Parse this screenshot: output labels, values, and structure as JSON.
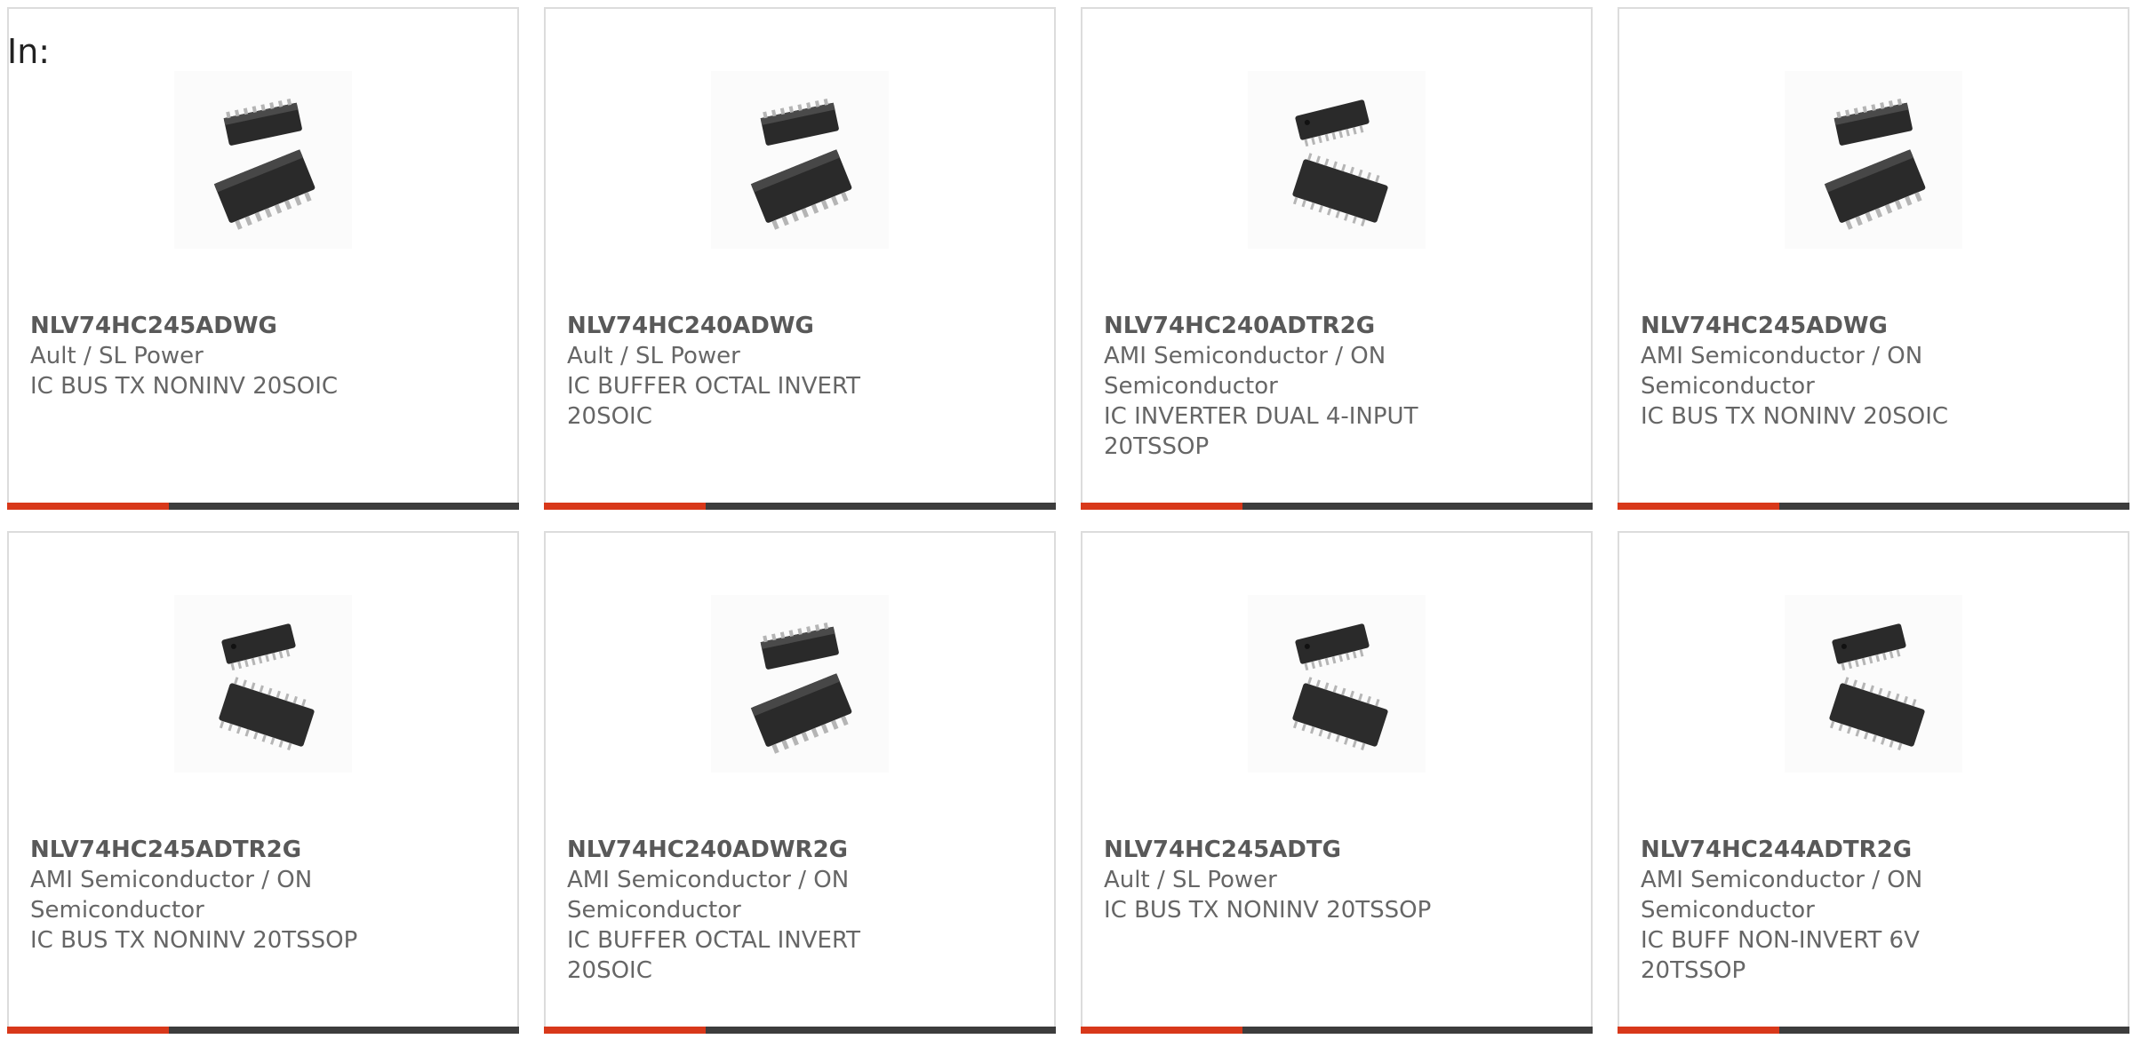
{
  "filter_label": "In:",
  "accent_color": "#d8381a",
  "bar_color": "#3d3d3d",
  "products": [
    {
      "part": "NLV74HC245ADWG",
      "manufacturer": "Ault / SL Power",
      "description": "IC BUS TX NONINV 20SOIC",
      "image_icon": "soic-chip-icon"
    },
    {
      "part": "NLV74HC240ADWG",
      "manufacturer": "Ault / SL Power",
      "description": "IC BUFFER OCTAL INVERT 20SOIC",
      "image_icon": "soic-chip-icon"
    },
    {
      "part": "NLV74HC240ADTR2G",
      "manufacturer": "AMI Semiconductor / ON Semiconductor",
      "description": "IC INVERTER DUAL 4-INPUT 20TSSOP",
      "image_icon": "tssop-chip-icon"
    },
    {
      "part": "NLV74HC245ADWG",
      "manufacturer": "AMI Semiconductor / ON Semiconductor",
      "description": "IC BUS TX NONINV 20SOIC",
      "image_icon": "soic-chip-icon"
    },
    {
      "part": "NLV74HC245ADTR2G",
      "manufacturer": "AMI Semiconductor / ON Semiconductor",
      "description": "IC BUS TX NONINV 20TSSOP",
      "image_icon": "tssop-chip-icon"
    },
    {
      "part": "NLV74HC240ADWR2G",
      "manufacturer": "AMI Semiconductor / ON Semiconductor",
      "description": "IC BUFFER OCTAL INVERT 20SOIC",
      "image_icon": "soic-chip-icon"
    },
    {
      "part": "NLV74HC245ADTG",
      "manufacturer": "Ault / SL Power",
      "description": "IC BUS TX NONINV 20TSSOP",
      "image_icon": "tssop-chip-icon"
    },
    {
      "part": "NLV74HC244ADTR2G",
      "manufacturer": "AMI Semiconductor / ON Semiconductor",
      "description": "IC BUFF NON-INVERT 6V 20TSSOP",
      "image_icon": "tssop-chip-icon"
    }
  ]
}
